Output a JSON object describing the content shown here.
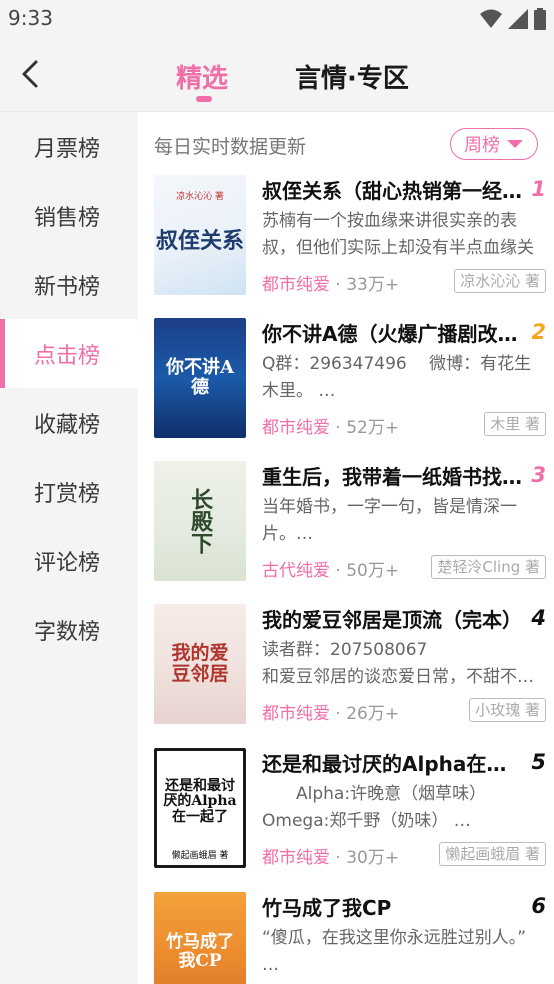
{
  "status_bar": {
    "time": "9:33"
  },
  "header": {
    "tabs": [
      {
        "label": "精选"
      },
      {
        "label": "言情·专区"
      }
    ]
  },
  "sidebar": {
    "items": [
      {
        "label": "月票榜"
      },
      {
        "label": "销售榜"
      },
      {
        "label": "新书榜"
      },
      {
        "label": "点击榜"
      },
      {
        "label": "收藏榜"
      },
      {
        "label": "打赏榜"
      },
      {
        "label": "评论榜"
      },
      {
        "label": "字数榜"
      }
    ],
    "active_index": 3
  },
  "main": {
    "update_text": "每日实时数据更新",
    "period_button": "周榜"
  },
  "colors": {
    "accent": "#f06fa8",
    "rank_top": [
      "#f06fa8",
      "#f5a623",
      "#f06fa8"
    ],
    "rank_other": "#111111"
  },
  "books": [
    {
      "rank": "1",
      "title": "叔侄关系（甜心热销第一经典）",
      "desc_lines": [
        "苏楠有一个按血缘来讲很实亲的表叔，但他们实际上却没有半点血缘关系"
      ],
      "category": "都市纯爱",
      "count": "· 33万+",
      "author": "凉水沁沁 著",
      "cover_text": "叔侄关系",
      "cover_sub": "凉水沁沁 著"
    },
    {
      "rank": "2",
      "title": "你不讲A德（火爆广播剧改编）",
      "desc_lines": [
        "Q群：296347496　 微博：有花生木里。 …"
      ],
      "category": "都市纯爱",
      "count": "· 52万+",
      "author": "木里 著",
      "cover_text": "你不讲A德"
    },
    {
      "rank": "3",
      "title": "重生后，我带着一纸婚书找上门",
      "desc_lines": [
        "当年婚书，一字一句，皆是情深一片。…"
      ],
      "category": "古代纯爱",
      "count": "· 50万+",
      "author": "楚轻泠Cling 著",
      "cover_text": "长殿下"
    },
    {
      "rank": "4",
      "title": "我的爱豆邻居是顶流（完本）",
      "desc_lines": [
        "读者群：207508067",
        "和爱豆邻居的谈恋爱日常，不甜不要钱"
      ],
      "category": "都市纯爱",
      "count": "· 26万+",
      "author": "小玫瑰 著",
      "cover_text": "我的爱豆邻居"
    },
    {
      "rank": "5",
      "title": "还是和最讨厌的Alpha在一起了",
      "desc_lines": [
        "　　Alpha:许晚意（烟草味）",
        "Omega:郑千野（奶味） …"
      ],
      "category": "都市纯爱",
      "count": "· 30万+",
      "author": "懒起画蛾眉 著",
      "cover_text": "还是和最讨厌的Alpha在一起了",
      "cover_sub": "懒起画蛾眉 著"
    },
    {
      "rank": "6",
      "title": "竹马成了我CP",
      "desc_lines": [
        "“傻瓜，在我这里你永远胜过别人。” …"
      ],
      "category": "",
      "count": "",
      "author": "",
      "cover_text": "竹马成了我CP"
    }
  ]
}
